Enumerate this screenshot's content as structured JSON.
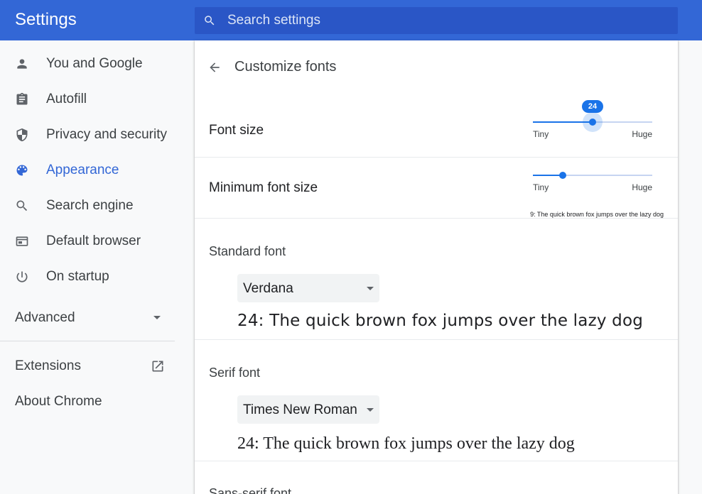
{
  "header": {
    "title": "Settings",
    "search_placeholder": "Search settings"
  },
  "sidebar": {
    "items": [
      {
        "label": "You and Google",
        "icon": "person-icon"
      },
      {
        "label": "Autofill",
        "icon": "clipboard-icon"
      },
      {
        "label": "Privacy and security",
        "icon": "shield-icon"
      },
      {
        "label": "Appearance",
        "icon": "palette-icon",
        "active": true
      },
      {
        "label": "Search engine",
        "icon": "search-icon"
      },
      {
        "label": "Default browser",
        "icon": "browser-window-icon"
      },
      {
        "label": "On startup",
        "icon": "power-icon"
      }
    ],
    "advanced_label": "Advanced",
    "extensions_label": "Extensions",
    "about_label": "About Chrome"
  },
  "page": {
    "title": "Customize fonts",
    "font_size": {
      "label": "Font size",
      "value": "24",
      "fraction": 0.5,
      "min_label": "Tiny",
      "max_label": "Huge"
    },
    "minimum_font_size": {
      "label": "Minimum font size",
      "fraction": 0.25,
      "min_label": "Tiny",
      "max_label": "Huge",
      "sample": "9: The quick brown fox jumps over the lazy dog"
    },
    "standard_font": {
      "label": "Standard font",
      "selected": "Verdana",
      "sample": "24: The quick brown fox jumps over the lazy dog"
    },
    "serif_font": {
      "label": "Serif font",
      "selected": "Times New Roman",
      "sample": "24: The quick brown fox jumps over the lazy dog"
    },
    "sans_serif_font": {
      "label": "Sans-serif font"
    }
  },
  "colors": {
    "accent": "#3367d6",
    "header_bg": "#3367d6",
    "slider": "#1a73e8"
  }
}
